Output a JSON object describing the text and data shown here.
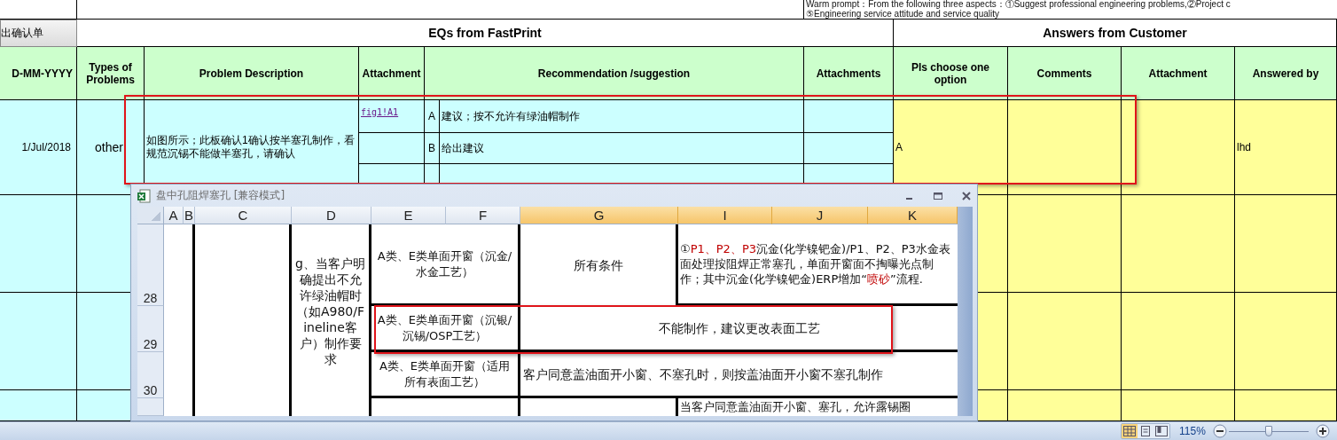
{
  "sheet": {
    "prompt_lines": [
      "Warm prompt：From the following three aspects：①Suggest professional engineering problems,②Project c",
      "⑤Engineering service attitude and service quality"
    ],
    "confirm_label": "出确认单",
    "groups": [
      "EQs from FastPrint",
      "Answers from Customer"
    ],
    "columns": [
      "D-MM-YYYY",
      "Types of Problems",
      "Problem Description",
      "Attachment",
      "Recommendation /suggestion",
      "Attachments",
      "Pls choose one option",
      "Comments",
      "Attachment",
      "Answered by"
    ],
    "row": {
      "date": "1/Jul/2018",
      "type": "other",
      "problem": "如图所示；此板确认1确认按半塞孔制作，看规范沉锡不能做半塞孔，请确认",
      "options": [
        {
          "letter": "A",
          "recommendation": "建议；按不允许有绿油帽制作",
          "attachment": "fig1!A1"
        },
        {
          "letter": "B",
          "recommendation": "给出建议"
        }
      ],
      "choice": "A",
      "answered_by": "lhd"
    }
  },
  "window": {
    "title": "盘中孔阻焊塞孔  [兼容模式]",
    "columns": [
      {
        "label": "A",
        "selected": false
      },
      {
        "label": "B",
        "selected": false
      },
      {
        "label": "C",
        "selected": false
      },
      {
        "label": "D",
        "selected": false
      },
      {
        "label": "E",
        "selected": false
      },
      {
        "label": "F",
        "selected": false
      },
      {
        "label": "G",
        "selected": true
      },
      {
        "label": "I",
        "selected": true
      },
      {
        "label": "J",
        "selected": true
      },
      {
        "label": "K",
        "selected": true
      }
    ],
    "row_numbers": [
      "28",
      "29",
      "30"
    ],
    "requirement": "g、当客户明确提出不允许绿油帽时（如A980/Fineline客户）制作要求",
    "finishes": [
      "A类、E类单面开窗（沉金/水金工艺）",
      "A类、E类单面开窗（沉银/沉锡/OSP工艺）",
      "A类、E类单面开窗（适用所有表面工艺）"
    ],
    "condition": "所有条件",
    "method": [
      {
        "text": "①",
        "highlight": false
      },
      {
        "text": "P1、P2、P3",
        "highlight": true
      },
      {
        "text": "沉金(化学镍钯金)/P1、P2、P3水金表面处理按阻焊正常塞孔，单面开窗面不掏曝光点制作；其中沉金(化学镍钯金)ERP增加“",
        "highlight": false
      },
      {
        "text": "喷砂",
        "highlight": true
      },
      {
        "text": "”流程.",
        "highlight": false
      }
    ],
    "row29": "不能制作，建议更改表面工艺",
    "row30": "客户同意盖油面开小窗、不塞孔时，则按盖油面开小窗不塞孔制作",
    "row31": "当客户同意盖油面开小窗、塞孔，允许露锡圈"
  },
  "status_bar": {
    "views": [
      {
        "kind": "normal",
        "selected": true
      },
      {
        "kind": "page_layout",
        "selected": false
      },
      {
        "kind": "page_break",
        "selected": false
      }
    ],
    "zoom": "115%",
    "zoom_slider": {
      "level": 0.5
    }
  }
}
